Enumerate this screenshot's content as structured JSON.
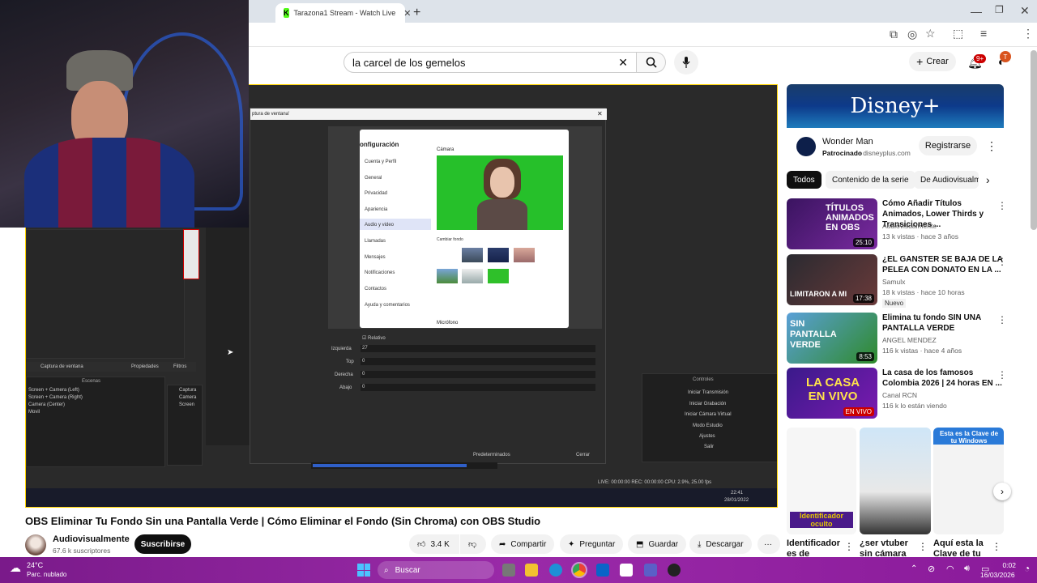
{
  "browser": {
    "tabs": [
      {
        "label": "Tarazona1 Stream - Watch Live"
      }
    ]
  },
  "youtube": {
    "search": {
      "value": "la carcel de los gemelos"
    },
    "create_label": "Crear",
    "notif_badge": "9+",
    "video": {
      "title": "OBS Eliminar Tu Fondo Sin una Pantalla Verde | Cómo Eliminar el Fondo (Sin Chroma) con OBS Studio",
      "channel": "Audiovisualmente",
      "subscribers": "67.6 k suscriptores",
      "subscribe_label": "Suscribirse",
      "likes": "3.4 K",
      "share": "Compartir",
      "ask": "Preguntar",
      "save": "Guardar",
      "download": "Descargar"
    },
    "inner_obs": {
      "window_capture": "Captura de ventana",
      "props": "Propiedades",
      "filters": "Filtros",
      "scenes_header": "Escenas",
      "scenes": [
        "Screen + Camera (Left)",
        "Screen + Camera (Right)",
        "Camera (Center)",
        "Movil"
      ],
      "sources": [
        "Captura",
        "Camera",
        "Screen"
      ],
      "controls_header": "Controles",
      "controls": [
        "Iniciar Transmisión",
        "Iniciar Grabación",
        "Iniciar Cámara Virtual",
        "Modo Estudio",
        "Ajustes",
        "Salir"
      ],
      "dialog_title": "ptura de ventana'",
      "settings_title": "onfiguración",
      "settings_items": [
        "Cuenta y Perfil",
        "General",
        "Privacidad",
        "Apariencia",
        "Audio y video",
        "Llamadas",
        "Mensajes",
        "Notificaciones",
        "Contactos",
        "Ayuda y comentarios"
      ],
      "camera_label": "Cámara",
      "change_bg": "Cambiar fondo",
      "mic_label": "Micrófono",
      "relative": "Relativo",
      "fields": [
        {
          "label": "Izquierda",
          "value": "27"
        },
        {
          "label": "Top",
          "value": "0"
        },
        {
          "label": "Derecha",
          "value": "0"
        },
        {
          "label": "Abajo",
          "value": "0"
        }
      ],
      "defaults_btn": "Predeterminados",
      "close_btn": "Cerrar",
      "status": "LIVE: 00:00:00   REC: 00:00:00   CPU: 2.9%, 25.00 fps",
      "clock": "22:41",
      "date": "28/01/2022"
    },
    "sidebar": {
      "ad": {
        "brand": "Disney+",
        "title": "Wonder Man",
        "sponsored": "Patrocinado",
        "domain": "disneyplus.com",
        "cta": "Registrarse"
      },
      "chips": [
        "Todos",
        "Contenido de la serie",
        "De Audiovisualm"
      ],
      "recs": [
        {
          "title": "Cómo Añadir Títulos Animados, Lower Thirds y Transiciones ...",
          "channel": "Audiovisualmente",
          "meta": "13 k vistas · hace 3 años",
          "duration": "25:10",
          "thumb_text": "TÍTULOS ANIMADOS EN OBS"
        },
        {
          "title": "¿EL GANSTER SE BAJA DE LA PELEA CON DONATO EN LA ...",
          "channel": "Samulx",
          "meta": "18 k vistas · hace 10 horas",
          "duration": "17:38",
          "badge": "Nuevo",
          "thumb_text": "LIMITARON A MI"
        },
        {
          "title": "Elimina tu fondo SIN UNA PANTALLA VERDE",
          "channel": "ANGEL MENDEZ",
          "meta": "116 k vistas · hace 4 años",
          "duration": "8:53",
          "thumb_text": "SIN PANTALLA VERDE"
        },
        {
          "title": "La casa de los famosos Colombia 2026 | 24 horas EN ...",
          "channel": "Canal RCN",
          "meta": "116 k lo están viendo",
          "live": "EN VIVO",
          "thumb_text": "LA CASA EN VIVO"
        }
      ],
      "shorts": [
        {
          "title": "Identificador es de"
        },
        {
          "title": "¿ser vtuber sin cámara"
        },
        {
          "title": "Aquí esta la Clave de tu"
        }
      ],
      "shorts_thumb_text": [
        "Identificador oculto",
        "",
        "Esta es la Clave de tu Windows"
      ]
    }
  },
  "taskbar": {
    "weather_temp": "24°C",
    "weather_desc": "Parc. nublado",
    "search": "Buscar",
    "time": "0:02",
    "date": "16/03/2026"
  },
  "colors": {
    "accent": "#cc0000",
    "taskbar": "#8a1a9a",
    "green_screen": "#26c02a",
    "player_border": "#ffd400"
  }
}
